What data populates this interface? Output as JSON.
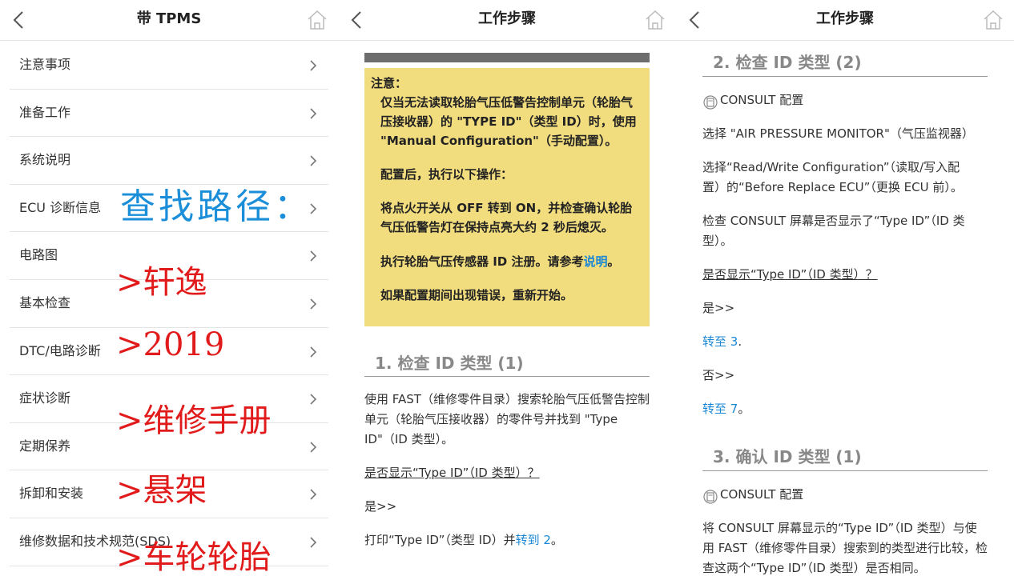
{
  "panel1": {
    "title": "带 TPMS",
    "items": [
      {
        "label": "注意事项"
      },
      {
        "label": "准备工作"
      },
      {
        "label": "系统说明"
      },
      {
        "label": "ECU 诊断信息"
      },
      {
        "label": "电路图"
      },
      {
        "label": "基本检查"
      },
      {
        "label": "DTC/电路诊断"
      },
      {
        "label": "症状诊断"
      },
      {
        "label": "定期保养"
      },
      {
        "label": "拆卸和安装"
      },
      {
        "label": "维修数据和技术规范(SDS)"
      }
    ],
    "annotations": {
      "path": "查找路径：",
      "lines": [
        ">轩逸",
        ">2019",
        ">维修手册",
        ">悬架",
        ">车轮轮胎"
      ]
    }
  },
  "panel2": {
    "title": "工作步骤",
    "note": {
      "title": "注意：",
      "p1": "仅当无法读取轮胎气压低警告控制单元（轮胎气压接收器）的 \"TYPE ID\"（类型 ID）时，使用 \"Manual Configuration\"（手动配置）。",
      "p2": "配置后，执行以下操作：",
      "p3": "将点火开关从 OFF 转到 ON，并检查确认轮胎气压低警告灯在保持点亮大约 2 秒后熄灭。",
      "p4_prefix": "执行轮胎气压传感器 ID 注册。请参考",
      "p4_link": "说明",
      "p4_suffix": "。",
      "p5": "如果配置期间出现错误，重新开始。"
    },
    "section1": {
      "heading": "1. 检查 ID 类型 (1)",
      "body": "使用 FAST（维修零件目录）搜索轮胎气压低警告控制单元（轮胎气压接收器）的零件号并找到 \"Type ID\"（ID 类型）。",
      "question": "是否显示“Type ID”（ID 类型）？",
      "yes": "是>>",
      "action_prefix": "打印“Type ID”（类型 ID）并",
      "action_link": "转到 2",
      "action_suffix": "。"
    }
  },
  "panel3": {
    "title": "工作步骤",
    "section2": {
      "heading": "2. 检查 ID 类型 (2)",
      "consult": "CONSULT 配置",
      "step1": "选择 \"AIR PRESSURE MONITOR\"（气压监视器）",
      "step2": "选择“Read/Write Configuration”（读取/写入配置）的“Before Replace ECU”（更换 ECU 前）。",
      "step3": "检查 CONSULT 屏幕是否显示了“Type ID”（ID 类型）。",
      "question": "是否显示“Type ID”（ID 类型）？",
      "yes": "是>>",
      "yes_link": "转至 3",
      "yes_suffix": ".",
      "no": "否>>",
      "no_link": "转至 7",
      "no_suffix": "。"
    },
    "section3": {
      "heading": "3. 确认 ID 类型 (1)",
      "consult": "CONSULT 配置",
      "body": "将 CONSULT 屏幕显示的“Type ID”（ID 类型）与使用 FAST（维修零件目录）搜索到的类型进行比较，检查这两个“Type ID”（ID 类型）是否相同。"
    }
  },
  "colors": {
    "note_bg": "#f1dc7e",
    "link": "#1a88d6",
    "annotation_blue": "#1a8ed8",
    "annotation_red": "#e11b1b"
  },
  "icons": [
    "back-arrow-icon",
    "home-icon",
    "chevron-right-icon",
    "consult-icon"
  ]
}
